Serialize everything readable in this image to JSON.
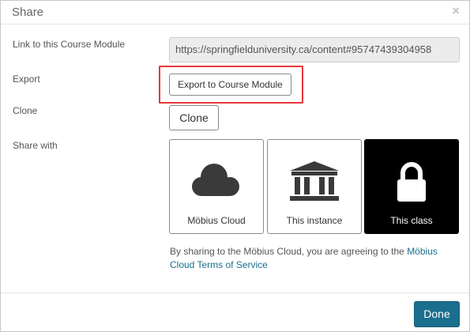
{
  "dialog": {
    "title": "Share",
    "close_glyph": "×"
  },
  "rows": {
    "link_label": "Link to this Course Module",
    "link_value": "https://springfielduniversity.ca/content#95747439304958",
    "export_label": "Export",
    "export_button": "Export to Course Module",
    "clone_label": "Clone",
    "clone_button": "Clone",
    "share_label": "Share with"
  },
  "share_options": [
    {
      "label": "Möbius Cloud",
      "icon": "cloud-icon",
      "selected": false
    },
    {
      "label": "This instance",
      "icon": "institution-icon",
      "selected": false
    },
    {
      "label": "This class",
      "icon": "lock-icon",
      "selected": true
    }
  ],
  "note": {
    "text": "By sharing to the Möbius Cloud, you are agreeing to the ",
    "link": "Möbius Cloud Terms of Service"
  },
  "footer": {
    "done_button": "Done"
  },
  "colors": {
    "primary": "#1b6f8e",
    "highlight": "#e8383b",
    "selected_tile": "#000000"
  }
}
